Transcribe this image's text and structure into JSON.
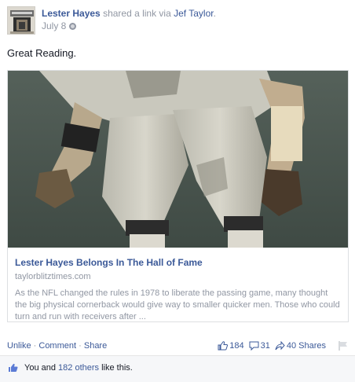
{
  "post": {
    "author": "Lester Hayes",
    "action_text": "shared a link via",
    "via_name": "Jef Taylor",
    "via_suffix": ".",
    "date": "July 8",
    "message": "Great Reading."
  },
  "link": {
    "title": "Lester Hayes Belongs In The Hall of Fame",
    "domain": "taylorblitztimes.com",
    "description": "As the NFL changed the rules in 1978 to liberate the passing game, many thought the big physical cornerback would give way to smaller quicker men. Those who could turn and run with receivers after ..."
  },
  "actions": {
    "unlike": "Unlike",
    "comment": "Comment",
    "share": "Share",
    "separator": "·"
  },
  "stats": {
    "likes": "184",
    "comments": "31",
    "shares": "40 Shares"
  },
  "likes_summary": {
    "prefix": "You and",
    "others": "182 others",
    "suffix": "like this."
  },
  "colors": {
    "link_blue": "#3b5998",
    "meta_gray": "#9197a3",
    "text": "#141823"
  }
}
